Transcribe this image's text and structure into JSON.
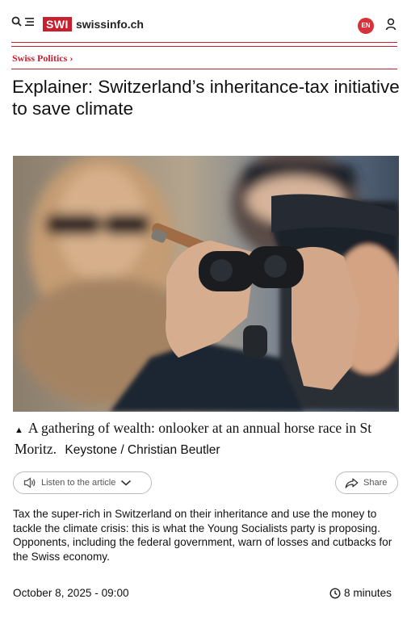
{
  "header": {
    "logo_mark": "SWI",
    "logo_text": "swissinfo.ch",
    "language": "EN"
  },
  "breadcrumb": {
    "label": "Swiss Politics",
    "chevron": "›"
  },
  "article": {
    "title": "Explainer: Switzerland’s inheritance-tax initiative to save climate",
    "image": {
      "caption_marker": "▲",
      "caption": "A gathering of wealth: onlooker at an annual horse race in St Moritz.",
      "credit": "Keystone / Christian Beutler"
    },
    "listen_label": "Listen to the article",
    "share_label": "Share",
    "lead": "Tax the super-rich in Switzerland on their inheritance and use the money to tackle the climate crisis: this is what the Young Socialists party is proposing. Opponents, including the federal government, warn of losses and cutbacks for the Swiss economy.",
    "date": "October 8, 2025 - 09:00",
    "read_time": "8 minutes"
  },
  "icons": [
    "search-icon",
    "menu-icon",
    "user-icon",
    "speaker-icon",
    "chevron-down-icon",
    "share-icon",
    "clock-icon"
  ],
  "colors": {
    "brand_red": "#c8202f",
    "lang_badge": "#d6323a"
  }
}
